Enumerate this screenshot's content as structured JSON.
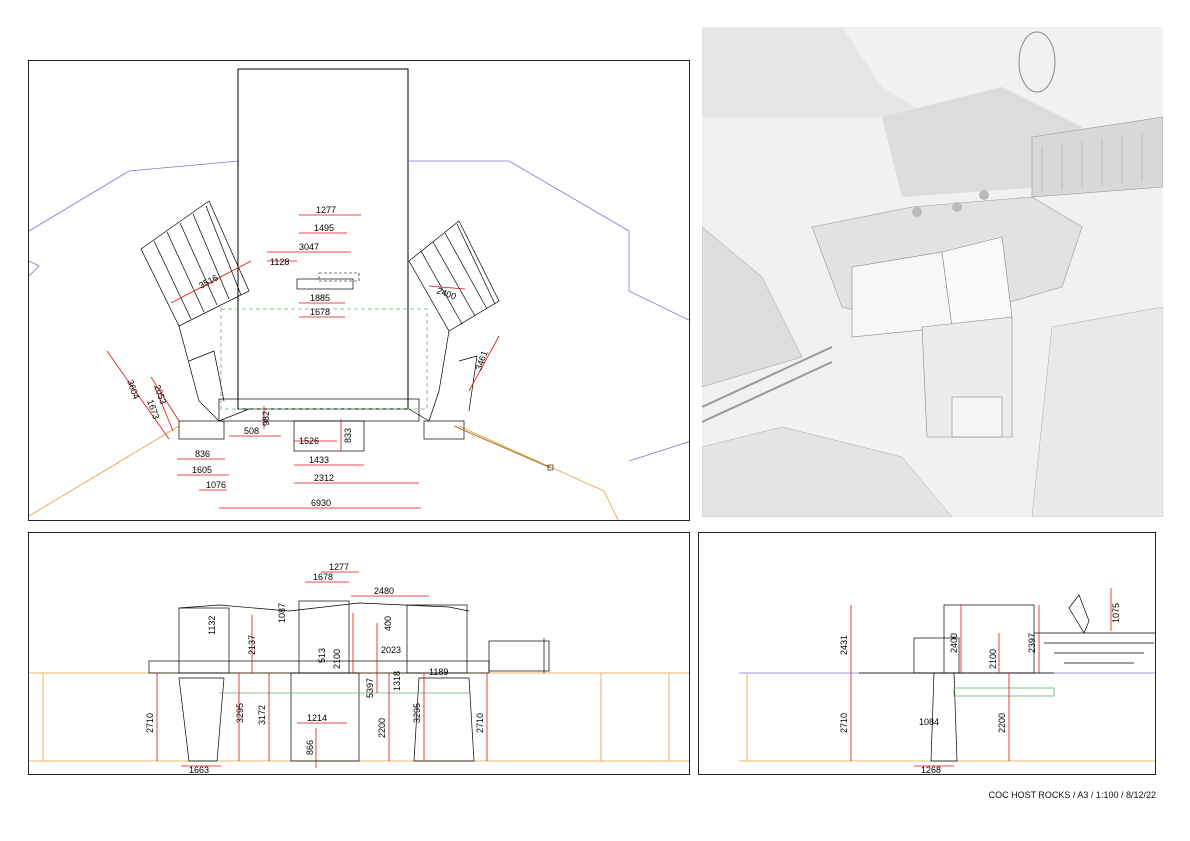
{
  "footer": {
    "title_block": "COC HOST ROCKS  / A3 / 1:100 / 8/12/22"
  },
  "plan": {
    "dims": [
      "1277",
      "1495",
      "3047",
      "1128",
      "1885",
      "1678",
      "3516",
      "2400",
      "3604",
      "2053",
      "1673",
      "3461",
      "982",
      "508",
      "833",
      "1526",
      "836",
      "1433",
      "1605",
      "2312",
      "1076",
      "6930"
    ]
  },
  "elevation_front": {
    "dims": [
      "1277",
      "1678",
      "2480",
      "1087",
      "2137",
      "1132",
      "400",
      "513",
      "2100",
      "2023",
      "5397",
      "1318",
      "1189",
      "2710",
      "3295",
      "3172",
      "1214",
      "866",
      "2200",
      "3295",
      "2710",
      "1663"
    ]
  },
  "elevation_side": {
    "dims": [
      "2431",
      "2400",
      "2397",
      "1075",
      "2100",
      "2710",
      "1084",
      "2200",
      "1268"
    ]
  },
  "render": {
    "alt": "3D view of host rock structures"
  }
}
